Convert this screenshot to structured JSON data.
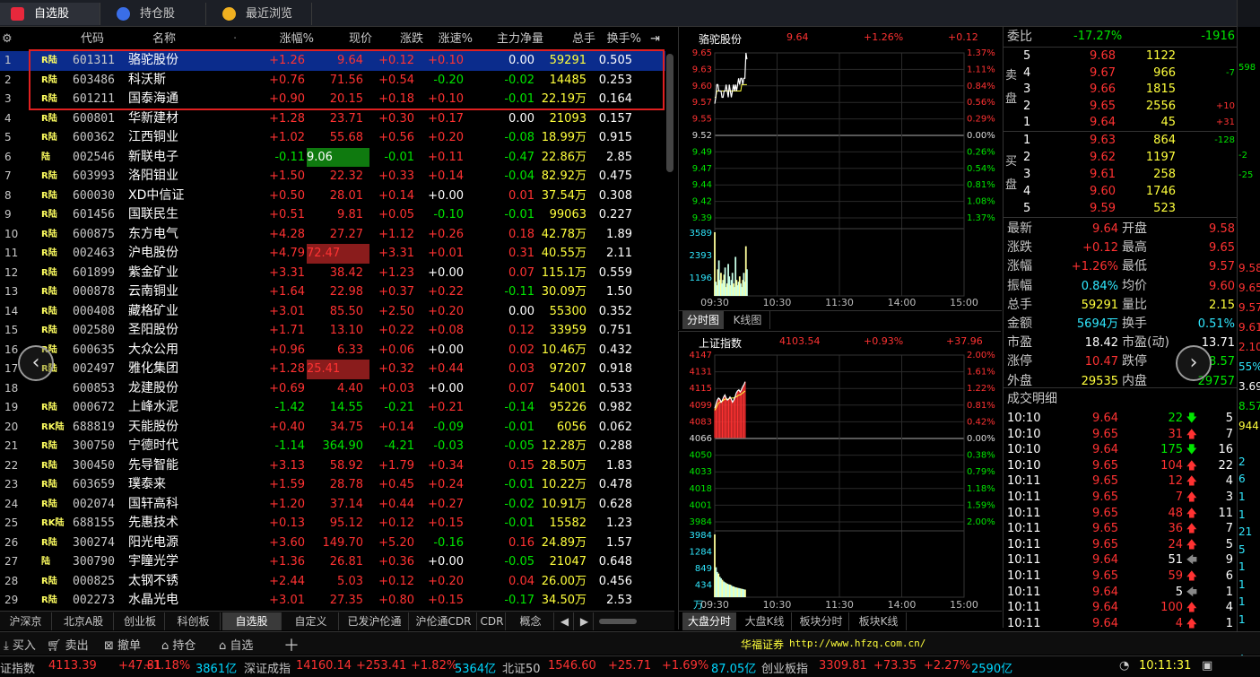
{
  "tabs": [
    {
      "label": "自选股",
      "active": true
    },
    {
      "label": "持仓股"
    },
    {
      "label": "最近浏览"
    }
  ],
  "table": {
    "headers": [
      "代码",
      "名称",
      "涨幅%",
      "现价",
      "涨跌",
      "涨速%",
      "主力净量",
      "总手",
      "换手%"
    ],
    "rows": [
      {
        "no": "1",
        "tag": "R陆",
        "code": "601311",
        "name": "骆驼股份",
        "pct": "+1.26",
        "price": "9.64",
        "chg": "+0.12",
        "spd": "+0.10",
        "net": "0.00",
        "vol": "59291",
        "turn": "0.505"
      },
      {
        "no": "2",
        "tag": "R陆",
        "code": "603486",
        "name": "科沃斯",
        "pct": "+0.76",
        "price": "71.56",
        "chg": "+0.54",
        "spd": "-0.20",
        "net": "-0.02",
        "vol": "14485",
        "turn": "0.253"
      },
      {
        "no": "3",
        "tag": "R陆",
        "code": "601211",
        "name": "国泰海通",
        "pct": "+0.90",
        "price": "20.15",
        "chg": "+0.18",
        "spd": "+0.10",
        "net": "-0.01",
        "vol": "22.19万",
        "turn": "0.164"
      },
      {
        "no": "4",
        "tag": "R陆",
        "code": "600801",
        "name": "华新建材",
        "pct": "+1.28",
        "price": "23.71",
        "chg": "+0.30",
        "spd": "+0.17",
        "net": "0.00",
        "vol": "21093",
        "turn": "0.157"
      },
      {
        "no": "5",
        "tag": "R陆",
        "code": "600362",
        "name": "江西铜业",
        "pct": "+1.02",
        "price": "55.68",
        "chg": "+0.56",
        "spd": "+0.20",
        "net": "-0.08",
        "vol": "18.99万",
        "turn": "0.915"
      },
      {
        "no": "6",
        "tag": "陆",
        "code": "002546",
        "name": "新联电子",
        "pct": "-0.11",
        "price": "9.06",
        "chg": "-0.01",
        "spd": "+0.11",
        "net": "-0.47",
        "vol": "22.86万",
        "turn": "2.85"
      },
      {
        "no": "7",
        "tag": "R陆",
        "code": "603993",
        "name": "洛阳钼业",
        "pct": "+1.50",
        "price": "22.32",
        "chg": "+0.33",
        "spd": "+0.14",
        "net": "-0.04",
        "vol": "82.92万",
        "turn": "0.475"
      },
      {
        "no": "8",
        "tag": "R陆",
        "code": "600030",
        "name": "XD中信证",
        "pct": "+0.50",
        "price": "28.01",
        "chg": "+0.14",
        "spd": "+0.00",
        "net": "0.01",
        "vol": "37.54万",
        "turn": "0.308"
      },
      {
        "no": "9",
        "tag": "R陆",
        "code": "601456",
        "name": "国联民生",
        "pct": "+0.51",
        "price": "9.81",
        "chg": "+0.05",
        "spd": "-0.10",
        "net": "-0.01",
        "vol": "99063",
        "turn": "0.227"
      },
      {
        "no": "10",
        "tag": "R陆",
        "code": "600875",
        "name": "东方电气",
        "pct": "+4.28",
        "price": "27.27",
        "chg": "+1.12",
        "spd": "+0.26",
        "net": "0.18",
        "vol": "42.78万",
        "turn": "1.89"
      },
      {
        "no": "11",
        "tag": "R陆",
        "code": "002463",
        "name": "沪电股份",
        "pct": "+4.79",
        "price": "72.47",
        "chg": "+3.31",
        "spd": "+0.01",
        "net": "0.31",
        "vol": "40.55万",
        "turn": "2.11"
      },
      {
        "no": "12",
        "tag": "R陆",
        "code": "601899",
        "name": "紫金矿业",
        "pct": "+3.31",
        "price": "38.42",
        "chg": "+1.23",
        "spd": "+0.00",
        "net": "0.07",
        "vol": "115.1万",
        "turn": "0.559"
      },
      {
        "no": "13",
        "tag": "R陆",
        "code": "000878",
        "name": "云南铜业",
        "pct": "+1.64",
        "price": "22.98",
        "chg": "+0.37",
        "spd": "+0.22",
        "net": "-0.11",
        "vol": "30.09万",
        "turn": "1.50"
      },
      {
        "no": "14",
        "tag": "R陆",
        "code": "000408",
        "name": "藏格矿业",
        "pct": "+3.01",
        "price": "85.50",
        "chg": "+2.50",
        "spd": "+0.20",
        "net": "0.00",
        "vol": "55300",
        "turn": "0.352"
      },
      {
        "no": "15",
        "tag": "R陆",
        "code": "002580",
        "name": "圣阳股份",
        "pct": "+1.71",
        "price": "13.10",
        "chg": "+0.22",
        "spd": "+0.08",
        "net": "0.12",
        "vol": "33959",
        "turn": "0.751"
      },
      {
        "no": "16",
        "tag": "R陆",
        "code": "600635",
        "name": "大众公用",
        "pct": "+0.96",
        "price": "6.33",
        "chg": "+0.06",
        "spd": "+0.00",
        "net": "0.02",
        "vol": "10.46万",
        "turn": "0.432"
      },
      {
        "no": "17",
        "tag": "R陆",
        "code": "002497",
        "name": "雅化集团",
        "pct": "+1.28",
        "price": "25.41",
        "chg": "+0.32",
        "spd": "+0.44",
        "net": "0.03",
        "vol": "97207",
        "turn": "0.918"
      },
      {
        "no": "18",
        "tag": "",
        "code": "600853",
        "name": "龙建股份",
        "pct": "+0.69",
        "price": "4.40",
        "chg": "+0.03",
        "spd": "+0.00",
        "net": "0.07",
        "vol": "54001",
        "turn": "0.533"
      },
      {
        "no": "19",
        "tag": "R陆",
        "code": "000672",
        "name": "上峰水泥",
        "pct": "-1.42",
        "price": "14.55",
        "chg": "-0.21",
        "spd": "+0.21",
        "net": "-0.14",
        "vol": "95226",
        "turn": "0.982"
      },
      {
        "no": "20",
        "tag": "RK陆",
        "code": "688819",
        "name": "天能股份",
        "pct": "+0.40",
        "price": "34.75",
        "chg": "+0.14",
        "spd": "-0.09",
        "net": "-0.01",
        "vol": "6056",
        "turn": "0.062"
      },
      {
        "no": "21",
        "tag": "R陆",
        "code": "300750",
        "name": "宁德时代",
        "pct": "-1.14",
        "price": "364.90",
        "chg": "-4.21",
        "spd": "-0.03",
        "net": "-0.05",
        "vol": "12.28万",
        "turn": "0.288"
      },
      {
        "no": "22",
        "tag": "R陆",
        "code": "300450",
        "name": "先导智能",
        "pct": "+3.13",
        "price": "58.92",
        "chg": "+1.79",
        "spd": "+0.34",
        "net": "0.15",
        "vol": "28.50万",
        "turn": "1.83"
      },
      {
        "no": "23",
        "tag": "R陆",
        "code": "603659",
        "name": "璞泰来",
        "pct": "+1.59",
        "price": "28.78",
        "chg": "+0.45",
        "spd": "+0.24",
        "net": "-0.01",
        "vol": "10.22万",
        "turn": "0.478"
      },
      {
        "no": "24",
        "tag": "R陆",
        "code": "002074",
        "name": "国轩高科",
        "pct": "+1.20",
        "price": "37.14",
        "chg": "+0.44",
        "spd": "+0.27",
        "net": "-0.02",
        "vol": "10.91万",
        "turn": "0.628"
      },
      {
        "no": "25",
        "tag": "RK陆",
        "code": "688155",
        "name": "先惠技术",
        "pct": "+0.13",
        "price": "95.12",
        "chg": "+0.12",
        "spd": "+0.15",
        "net": "-0.01",
        "vol": "15582",
        "turn": "1.23"
      },
      {
        "no": "26",
        "tag": "R陆",
        "code": "300274",
        "name": "阳光电源",
        "pct": "+3.60",
        "price": "149.70",
        "chg": "+5.20",
        "spd": "-0.16",
        "net": "0.16",
        "vol": "24.89万",
        "turn": "1.57"
      },
      {
        "no": "27",
        "tag": "陆",
        "code": "300790",
        "name": "宇瞳光学",
        "pct": "+1.36",
        "price": "26.81",
        "chg": "+0.36",
        "spd": "+0.00",
        "net": "-0.05",
        "vol": "21047",
        "turn": "0.648"
      },
      {
        "no": "28",
        "tag": "R陆",
        "code": "000825",
        "name": "太钢不锈",
        "pct": "+2.44",
        "price": "5.03",
        "chg": "+0.12",
        "spd": "+0.20",
        "net": "0.04",
        "vol": "26.00万",
        "turn": "0.456"
      },
      {
        "no": "29",
        "tag": "R陆",
        "code": "002273",
        "name": "水晶光电",
        "pct": "+3.01",
        "price": "27.35",
        "chg": "+0.80",
        "spd": "+0.15",
        "net": "-0.17",
        "vol": "34.50万",
        "turn": "2.53"
      }
    ]
  },
  "bottom_tabs": [
    "沪深京",
    "北京A股",
    "创业板",
    "科创板",
    "自选股",
    "自定义",
    "已发沪伦通",
    "沪伦通CDR",
    "CDR",
    "概念"
  ],
  "stock_chart": {
    "name": "骆驼股份",
    "price": "9.64",
    "pct": "+1.26%",
    "chg": "+0.12",
    "yleft": [
      "9.65",
      "9.63",
      "9.60",
      "9.57",
      "9.55",
      "9.52",
      "9.49",
      "9.47",
      "9.44",
      "9.42",
      "9.39"
    ],
    "yright": [
      "1.37%",
      "1.11%",
      "0.84%",
      "0.56%",
      "0.29%",
      "0.00%",
      "0.26%",
      "0.54%",
      "0.81%",
      "1.08%",
      "1.37%"
    ],
    "vol": [
      "3589",
      "2393",
      "1196"
    ],
    "times": [
      "09:30",
      "10:30",
      "11:30",
      "14:00",
      "15:00"
    ],
    "tabs": [
      "分时图",
      "K线图"
    ],
    "prices": [
      9.57,
      9.58,
      9.6,
      9.6,
      9.59,
      9.59,
      9.59,
      9.58,
      9.58,
      9.59,
      9.59,
      9.6,
      9.59,
      9.58,
      9.6,
      9.59,
      9.58,
      9.59,
      9.6,
      9.59,
      9.6,
      9.59,
      9.6,
      9.61,
      9.6,
      9.61,
      9.61,
      9.6,
      9.61,
      9.61,
      9.65,
      9.64
    ],
    "avg": [
      9.58,
      9.58,
      9.59,
      9.59,
      9.59,
      9.59,
      9.59,
      9.59,
      9.59,
      9.59,
      9.59,
      9.59,
      9.59,
      9.59,
      9.59,
      9.59,
      9.59,
      9.59,
      9.59,
      9.59,
      9.59,
      9.59,
      9.59,
      9.59,
      9.59,
      9.59,
      9.6,
      9.6,
      9.6,
      9.6,
      9.6,
      9.6
    ],
    "volumes": [
      3589,
      800,
      600,
      1500,
      2000,
      900,
      1300,
      700,
      900,
      1200,
      1600,
      500,
      700,
      1800,
      1100,
      600,
      900,
      1300,
      700,
      500,
      2200,
      900,
      600,
      800,
      1100,
      700,
      500,
      900,
      1300,
      800,
      2800,
      1500
    ]
  },
  "index_chart": {
    "name": "上证指数",
    "price": "4103.54",
    "pct": "+0.93%",
    "chg": "+37.96",
    "yleft": [
      "4147",
      "4131",
      "4115",
      "4099",
      "4083",
      "4066",
      "4050",
      "4033",
      "4018",
      "4001",
      "3984"
    ],
    "yright": [
      "2.00%",
      "1.61%",
      "1.22%",
      "0.81%",
      "0.42%",
      "0.00%",
      "0.38%",
      "0.79%",
      "1.18%",
      "1.59%",
      "2.00%"
    ],
    "vol": [
      "3984",
      "1284",
      "849",
      "434"
    ],
    "vol_unit": "万",
    "times": [
      "09:30",
      "10:30",
      "11:30",
      "14:00",
      "15:00"
    ],
    "tabs": [
      "大盘分时",
      "大盘K线",
      "板块分时",
      "板块K线"
    ],
    "prices": [
      4095,
      4099,
      4103,
      4105,
      4104,
      4101,
      4103,
      4106,
      4108,
      4105,
      4103,
      4104,
      4106,
      4104,
      4101,
      4103,
      4106,
      4110,
      4112,
      4113,
      4111,
      4113,
      4116,
      4118,
      4121
    ],
    "avg": [
      4093,
      4095,
      4098,
      4100,
      4101,
      4101,
      4102,
      4103,
      4104,
      4104,
      4104,
      4104,
      4105,
      4105,
      4105,
      4105,
      4106,
      4106,
      4107,
      4108,
      4108,
      4109,
      4110,
      4111,
      4112
    ],
    "volumes": [
      3984,
      1900,
      1600,
      1500,
      1300,
      1200,
      1100,
      1000,
      950,
      900,
      850,
      820,
      800,
      760,
      700,
      680,
      640,
      620,
      600,
      580,
      560,
      540,
      520,
      500,
      480
    ]
  },
  "orderbook": {
    "weibi_label": "委比",
    "weibi_pct": "-17.27%",
    "weibi_val": "-1916",
    "sell_label": "卖盘",
    "buy_label": "买盘",
    "sells": [
      {
        "lv": "5",
        "p": "9.68",
        "v": "1122"
      },
      {
        "lv": "4",
        "p": "9.67",
        "v": "966"
      },
      {
        "lv": "3",
        "p": "9.66",
        "v": "1815"
      },
      {
        "lv": "2",
        "p": "9.65",
        "v": "2556"
      },
      {
        "lv": "1",
        "p": "9.64",
        "v": "45"
      }
    ],
    "buys": [
      {
        "lv": "1",
        "p": "9.63",
        "v": "864"
      },
      {
        "lv": "2",
        "p": "9.62",
        "v": "1197"
      },
      {
        "lv": "3",
        "p": "9.61",
        "v": "258"
      },
      {
        "lv": "4",
        "p": "9.60",
        "v": "1746"
      },
      {
        "lv": "5",
        "p": "9.59",
        "v": "523"
      }
    ],
    "side_sell": [
      "",
      "-7",
      "",
      "+10",
      "+31"
    ],
    "side_buy": [
      "-128",
      "",
      "",
      "",
      ""
    ]
  },
  "quote": [
    [
      "最新",
      "9.64",
      "开盘",
      "9.58"
    ],
    [
      "涨跌",
      "+0.12",
      "最高",
      "9.65"
    ],
    [
      "涨幅",
      "+1.26%",
      "最低",
      "9.57"
    ],
    [
      "振幅",
      "0.84%",
      "均价",
      "9.60"
    ],
    [
      "总手",
      "59291",
      "量比",
      "2.15"
    ],
    [
      "金额",
      "5694万",
      "换手",
      "0.51%"
    ],
    [
      "市盈",
      "18.42",
      "市盈(动)",
      "13.71"
    ],
    [
      "涨停",
      "10.47",
      "跌停",
      "8.57"
    ],
    [
      "外盘",
      "29535",
      "内盘",
      "29757"
    ]
  ],
  "ticks_title": "成交明细",
  "ticks": [
    [
      "10:10",
      "9.64",
      "22",
      "down",
      "5"
    ],
    [
      "10:10",
      "9.65",
      "31",
      "up",
      "7"
    ],
    [
      "10:10",
      "9.64",
      "175",
      "down",
      "16"
    ],
    [
      "10:10",
      "9.65",
      "104",
      "up",
      "22"
    ],
    [
      "10:11",
      "9.65",
      "12",
      "up",
      "4"
    ],
    [
      "10:11",
      "9.65",
      "7",
      "up",
      "3"
    ],
    [
      "10:11",
      "9.65",
      "48",
      "up",
      "11"
    ],
    [
      "10:11",
      "9.65",
      "36",
      "up",
      "7"
    ],
    [
      "10:11",
      "9.65",
      "24",
      "up",
      "5"
    ],
    [
      "10:11",
      "9.64",
      "51",
      "left",
      "9"
    ],
    [
      "10:11",
      "9.65",
      "59",
      "up",
      "6"
    ],
    [
      "10:11",
      "9.64",
      "5",
      "left",
      "1"
    ],
    [
      "10:11",
      "9.64",
      "100",
      "up",
      "4"
    ],
    [
      "10:11",
      "9.64",
      "4",
      "up",
      "1"
    ]
  ],
  "edge_right": [
    "598",
    "-2",
    "-25",
    "9.58",
    "9.65",
    "9.57",
    "9.61",
    "2.10",
    "55%",
    "3.69",
    "8.57",
    "944",
    "2",
    "6",
    "1",
    "1",
    "21",
    "5",
    "1",
    "1",
    "1",
    "1",
    "5",
    "1",
    "2",
    "3"
  ],
  "toolbar": [
    "买入",
    "卖出",
    "撤单",
    "持仓",
    "自选"
  ],
  "broker": {
    "name": "华福证券",
    "url": "http://www.hfzq.com.cn/"
  },
  "status": {
    "idx1_name": "证指数",
    "idx1_val": "4113.39",
    "idx1_chg": "+47.81",
    "idx1_pct": "+1.18%",
    "idx1_amt": "3861亿",
    "idx2_name": "深证成指",
    "idx2_val": "14160.14",
    "idx2_chg": "+253.41",
    "idx2_pct": "+1.82%",
    "idx2_amt": "5364亿",
    "idx3_name": "北证50",
    "idx3_val": "1546.60",
    "idx3_chg": "+25.71",
    "idx3_pct": "+1.69%",
    "idx3_amt": "87.05亿",
    "idx4_name": "创业板指",
    "idx4_val": "3309.81",
    "idx4_chg": "+73.35",
    "idx4_pct": "+2.27%",
    "idx4_amt": "2590亿",
    "time": "10:11:31"
  },
  "colors": {
    "up": "#ff3232",
    "down": "#00e600",
    "selected_row": "#0b2c8c",
    "highlight_box": "#e02020",
    "price_line": "#ffffff",
    "avg_line": "#ffff3c"
  }
}
